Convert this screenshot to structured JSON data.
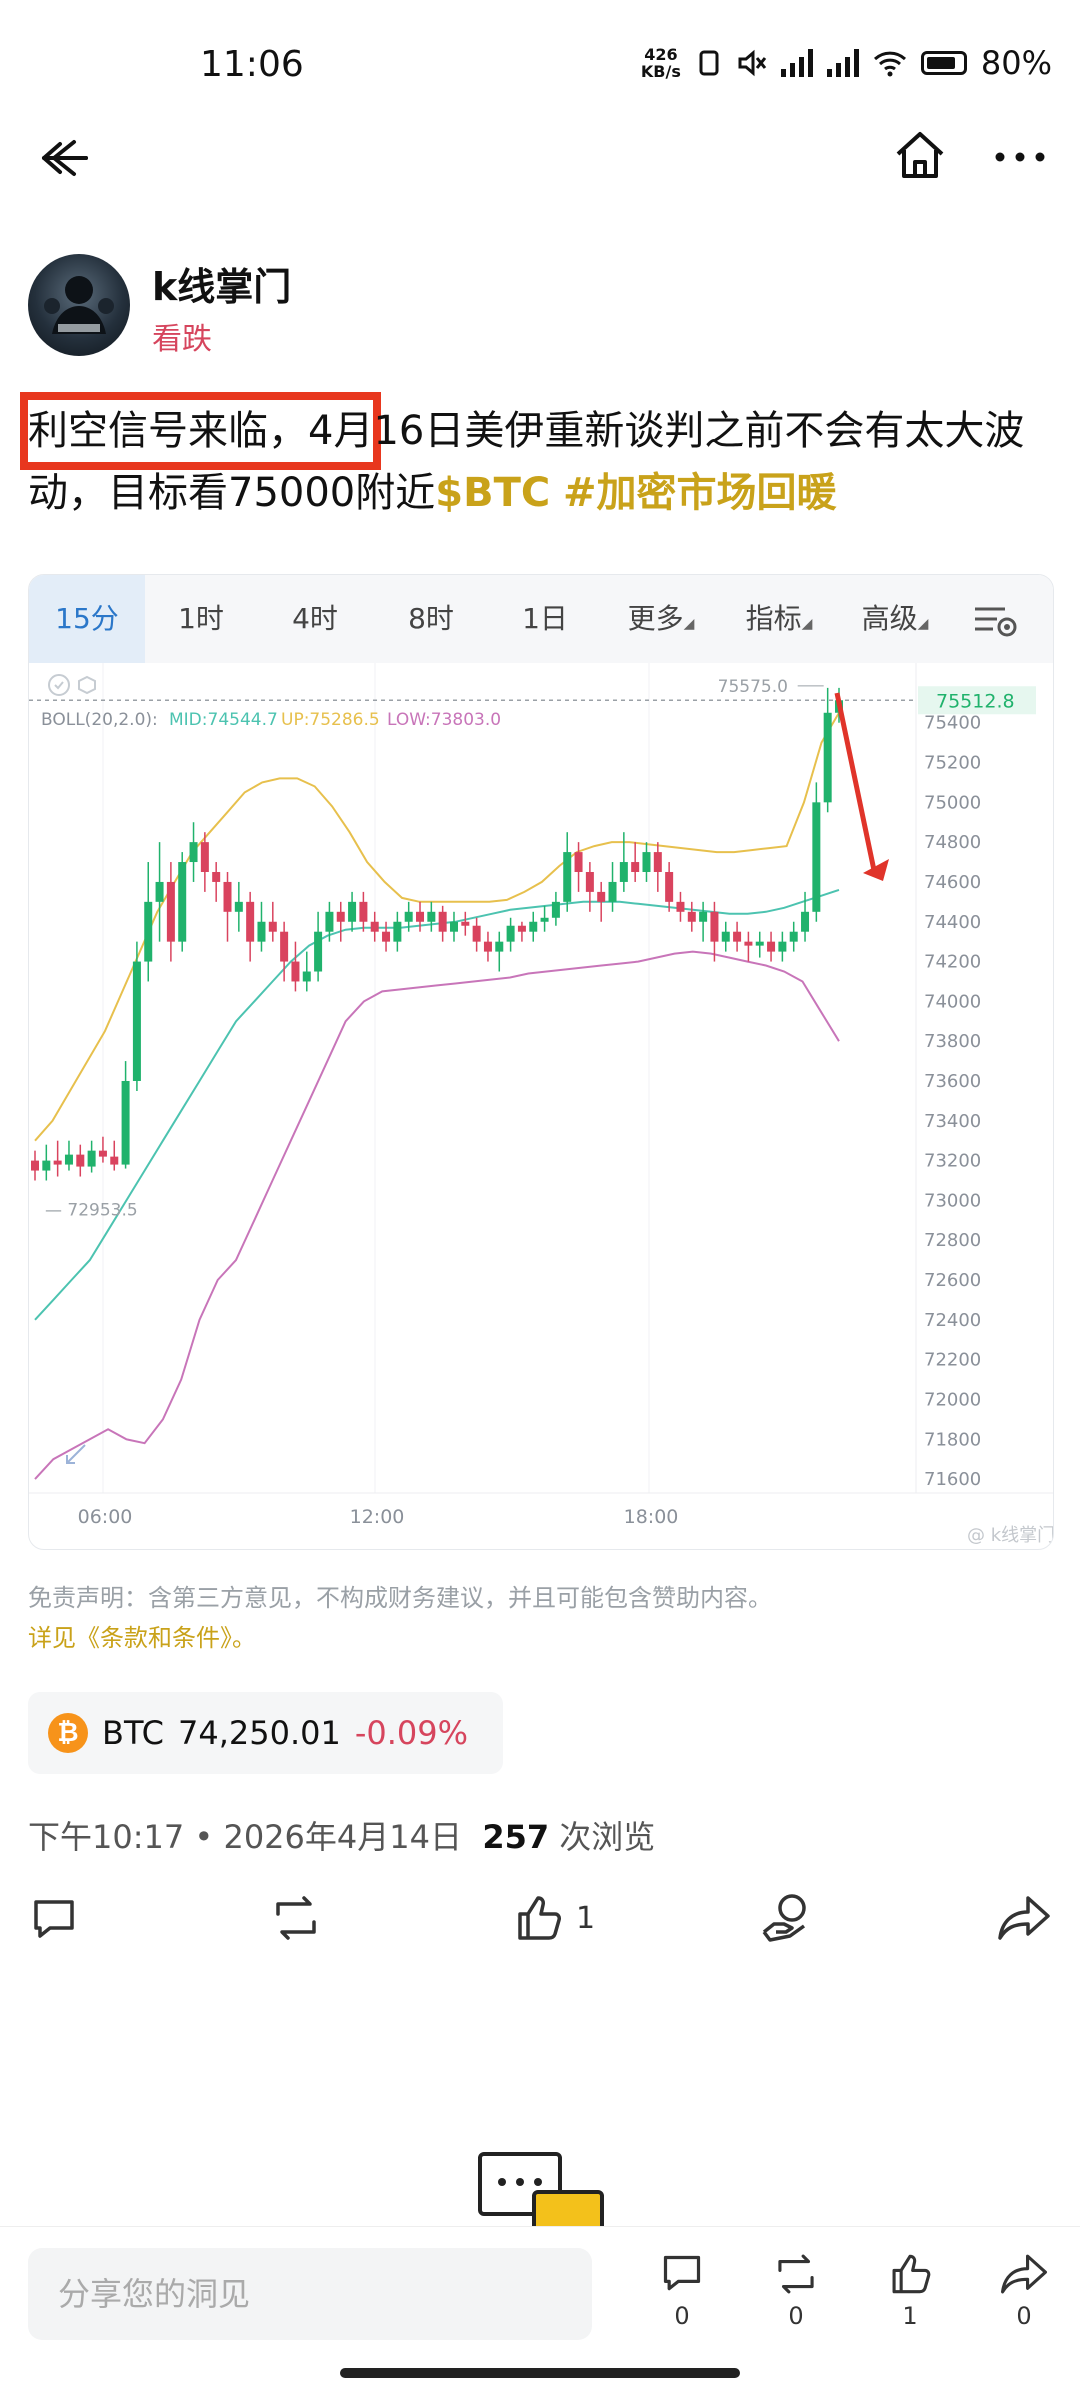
{
  "status_bar": {
    "time": "11:06",
    "net_speed_value": "426",
    "net_speed_unit": "KB/s",
    "battery": "80%"
  },
  "nav": {
    "back_icon": "arrow-left-icon",
    "home_icon": "home-icon",
    "more_icon": "more-icon"
  },
  "author": {
    "name": "k线掌门",
    "sentiment": "看跌"
  },
  "post": {
    "text_highlighted": "利空信号来临，4月",
    "text_rest": "16日美伊重新谈判之前不会有太大波动，目标看75000附近",
    "tag_btc": "$BTC",
    "tag_topic": "#加密市场回暖"
  },
  "chart": {
    "tabs": [
      {
        "label": "15分",
        "active": true
      },
      {
        "label": "1时"
      },
      {
        "label": "4时"
      },
      {
        "label": "8时"
      },
      {
        "label": "1日"
      },
      {
        "label": "更多"
      },
      {
        "label": "指标"
      },
      {
        "label": "高级"
      }
    ],
    "indicator_name": "BOLL(20,2.0):",
    "mid_label": "MID:74544.7",
    "up_label": "UP:75286.5",
    "low_label": "LOW:73803.0",
    "high_marker": "75575.0",
    "low_marker": "72953.5",
    "current_price": "75512.8",
    "watermark": "@ k线掌门",
    "colors": {
      "up": "#20b26c",
      "down": "#d9435e",
      "mid_line": "#4cc3b0",
      "up_line": "#e7c04d",
      "low_line": "#c875b9",
      "arrow": "#e0342a"
    }
  },
  "chart_data": {
    "type": "candlestick",
    "y_ticks": [
      75400,
      75200,
      75000,
      74800,
      74600,
      74400,
      74200,
      74000,
      73800,
      73600,
      73400,
      73200,
      73000,
      72800,
      72600,
      72400,
      72200,
      72000,
      71800,
      71600
    ],
    "x_ticks": [
      "06:00",
      "12:00",
      "18:00"
    ],
    "ylim": [
      71530,
      75700
    ],
    "current_price": 75512.8,
    "candles": [
      [
        73200,
        73150,
        73250,
        73100
      ],
      [
        73150,
        73200,
        73280,
        73100
      ],
      [
        73200,
        73180,
        73300,
        73120
      ],
      [
        73180,
        73230,
        73300,
        73150
      ],
      [
        73230,
        73170,
        73280,
        73120
      ],
      [
        73170,
        73250,
        73300,
        73140
      ],
      [
        73250,
        73220,
        73320,
        73190
      ],
      [
        73220,
        73180,
        73300,
        73150
      ],
      [
        73180,
        73600,
        73700,
        73160
      ],
      [
        73600,
        74200,
        74300,
        73550
      ],
      [
        74200,
        74500,
        74700,
        74100
      ],
      [
        74500,
        74600,
        74800,
        74300
      ],
      [
        74600,
        74300,
        74700,
        74200
      ],
      [
        74300,
        74700,
        74750,
        74250
      ],
      [
        74700,
        74800,
        74900,
        74600
      ],
      [
        74800,
        74650,
        74850,
        74550
      ],
      [
        74650,
        74600,
        74700,
        74500
      ],
      [
        74600,
        74450,
        74650,
        74300
      ],
      [
        74450,
        74500,
        74600,
        74350
      ],
      [
        74500,
        74300,
        74550,
        74200
      ],
      [
        74300,
        74400,
        74500,
        74250
      ],
      [
        74400,
        74350,
        74500,
        74300
      ],
      [
        74350,
        74200,
        74400,
        74100
      ],
      [
        74200,
        74100,
        74300,
        74050
      ],
      [
        74100,
        74150,
        74250,
        74050
      ],
      [
        74150,
        74350,
        74450,
        74100
      ],
      [
        74350,
        74450,
        74500,
        74300
      ],
      [
        74450,
        74400,
        74500,
        74300
      ],
      [
        74400,
        74500,
        74550,
        74350
      ],
      [
        74500,
        74400,
        74550,
        74350
      ],
      [
        74400,
        74350,
        74450,
        74300
      ],
      [
        74350,
        74300,
        74400,
        74250
      ],
      [
        74300,
        74400,
        74450,
        74250
      ],
      [
        74400,
        74450,
        74500,
        74350
      ],
      [
        74450,
        74400,
        74500,
        74350
      ],
      [
        74400,
        74450,
        74500,
        74350
      ],
      [
        74450,
        74350,
        74480,
        74300
      ],
      [
        74350,
        74400,
        74450,
        74300
      ],
      [
        74400,
        74380,
        74450,
        74330
      ],
      [
        74380,
        74300,
        74420,
        74250
      ],
      [
        74300,
        74250,
        74350,
        74200
      ],
      [
        74250,
        74300,
        74350,
        74150
      ],
      [
        74300,
        74380,
        74420,
        74250
      ],
      [
        74380,
        74350,
        74400,
        74300
      ],
      [
        74350,
        74400,
        74450,
        74300
      ],
      [
        74400,
        74420,
        74480,
        74350
      ],
      [
        74420,
        74500,
        74550,
        74380
      ],
      [
        74500,
        74750,
        74850,
        74450
      ],
      [
        74750,
        74650,
        74800,
        74550
      ],
      [
        74650,
        74550,
        74700,
        74450
      ],
      [
        74550,
        74500,
        74600,
        74400
      ],
      [
        74500,
        74600,
        74700,
        74450
      ],
      [
        74600,
        74700,
        74850,
        74550
      ],
      [
        74700,
        74650,
        74800,
        74600
      ],
      [
        74650,
        74750,
        74800,
        74600
      ],
      [
        74750,
        74650,
        74800,
        74550
      ],
      [
        74650,
        74500,
        74700,
        74450
      ],
      [
        74500,
        74450,
        74550,
        74400
      ],
      [
        74450,
        74400,
        74500,
        74350
      ],
      [
        74400,
        74450,
        74500,
        74300
      ],
      [
        74450,
        74300,
        74500,
        74200
      ],
      [
        74300,
        74350,
        74400,
        74250
      ],
      [
        74350,
        74300,
        74400,
        74250
      ],
      [
        74300,
        74280,
        74350,
        74200
      ],
      [
        74280,
        74300,
        74350,
        74220
      ],
      [
        74300,
        74250,
        74350,
        74200
      ],
      [
        74250,
        74300,
        74350,
        74200
      ],
      [
        74300,
        74350,
        74400,
        74250
      ],
      [
        74350,
        74450,
        74550,
        74300
      ],
      [
        74450,
        75000,
        75100,
        74400
      ],
      [
        75000,
        75450,
        75575,
        74950
      ],
      [
        75450,
        75512.8,
        75575,
        75400
      ]
    ],
    "boll_up": [
      73300,
      73400,
      73550,
      73700,
      73850,
      74050,
      74250,
      74450,
      74600,
      74750,
      74850,
      74950,
      75050,
      75100,
      75120,
      75120,
      75080,
      74980,
      74850,
      74700,
      74600,
      74520,
      74500,
      74500,
      74500,
      74500,
      74500,
      74510,
      74550,
      74600,
      74680,
      74750,
      74780,
      74800,
      74800,
      74790,
      74780,
      74770,
      74760,
      74750,
      74750,
      74760,
      74770,
      74780,
      75000,
      75300,
      75450
    ],
    "boll_mid": [
      72400,
      72500,
      72600,
      72700,
      72850,
      73000,
      73150,
      73300,
      73450,
      73600,
      73750,
      73900,
      74000,
      74100,
      74200,
      74280,
      74330,
      74360,
      74370,
      74370,
      74370,
      74380,
      74390,
      74400,
      74420,
      74440,
      74460,
      74470,
      74480,
      74490,
      74500,
      74500,
      74500,
      74490,
      74480,
      74470,
      74460,
      74450,
      74440,
      74440,
      74450,
      74470,
      74500,
      74530,
      74560
    ],
    "boll_low": [
      71600,
      71700,
      71750,
      71800,
      71850,
      71800,
      71780,
      71900,
      72100,
      72400,
      72600,
      72700,
      72900,
      73100,
      73300,
      73500,
      73700,
      73900,
      74000,
      74050,
      74060,
      74070,
      74080,
      74090,
      74100,
      74110,
      74120,
      74140,
      74150,
      74160,
      74170,
      74180,
      74190,
      74200,
      74220,
      74240,
      74250,
      74240,
      74220,
      74200,
      74180,
      74150,
      74100,
      73950,
      73800
    ]
  },
  "disclaimer": "免责声明：含第三方意见，不构成财务建议，并且可能包含赞助内容。",
  "terms_link": "详见《条款和条件》。",
  "ticker": {
    "coin_symbol": "₿",
    "symbol": "BTC",
    "price": "74,250.01",
    "change": "-0.09%"
  },
  "meta": {
    "time": "下午10:17",
    "dot": "•",
    "date": "2026年4月14日",
    "views_count": "257",
    "views_label": "次浏览"
  },
  "actions": {
    "like_count": "1"
  },
  "bottom_bar": {
    "input_placeholder": "分享您的洞见",
    "comment_count": "0",
    "repost_count": "0",
    "like_count": "1",
    "share_count": "0"
  }
}
